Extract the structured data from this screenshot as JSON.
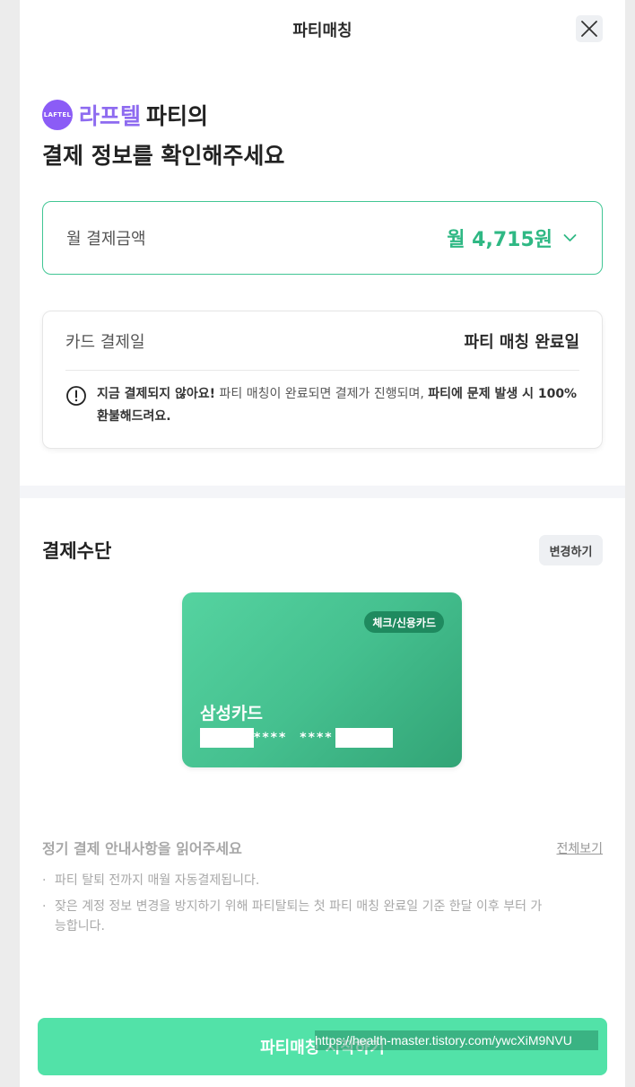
{
  "header": {
    "title": "파티매칭",
    "close_icon": "close-icon"
  },
  "headline": {
    "logo_text": "LAFTEL",
    "brand": "라프텔",
    "party_of": "파티의",
    "line2": "결제 정보를 확인해주세요"
  },
  "amount": {
    "label": "월 결제금액",
    "value": "월 4,715원",
    "icon": "chevron-down-icon"
  },
  "paydate": {
    "label": "카드 결제일",
    "value": "파티 매칭 완료일",
    "notice_icon": "alert-circle-icon",
    "notice_bold1": "지금 결제되지 않아요!",
    "notice_text1": " 파티 매칭이 완료되면 결제가 진행되며, ",
    "notice_bold2": "파티에 문제 발생 시 100% 환불해드려요."
  },
  "payment_method": {
    "title": "결제수단",
    "change_label": "변경하기",
    "card": {
      "type": "체크/신용카드",
      "name": "삼성카드",
      "mask1": "****",
      "mask2": "****"
    }
  },
  "notes": {
    "title": "정기 결제 안내사항을 읽어주세요",
    "view_all": "전체보기",
    "items": [
      "파티 탈퇴 전까지 매월 자동결제됩니다.",
      "잦은 계정 정보 변경을 방지하기 위해 파티탈퇴는 첫 파티 매칭 완료일 기준 한달 이후 부터 가능합니다."
    ]
  },
  "cta": {
    "label": "파티매칭 시작하기"
  },
  "watermark": "https://health-master.tistory.com/ywcXiM9NVU",
  "colors": {
    "accent": "#41c694",
    "brand": "#8e6bf0",
    "cta": "#52e2a8"
  }
}
